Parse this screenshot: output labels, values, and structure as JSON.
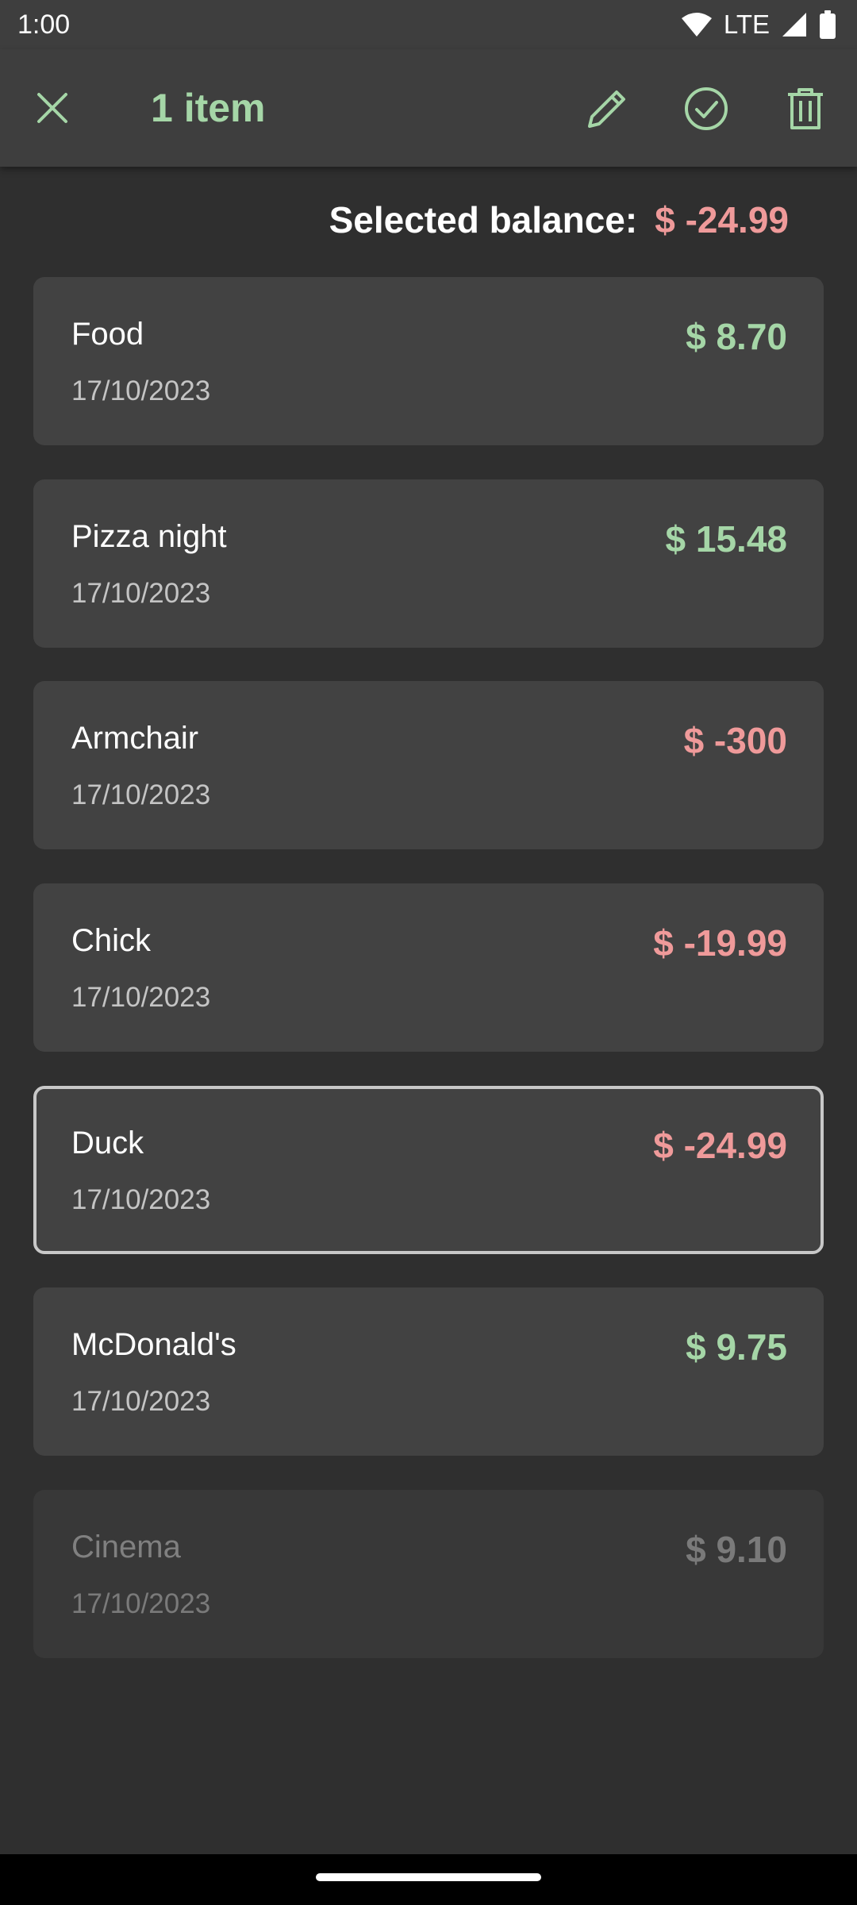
{
  "status_bar": {
    "time": "1:00",
    "network": "LTE",
    "icons": [
      "wifi-icon",
      "cell-signal-icon",
      "battery-icon"
    ]
  },
  "app_bar": {
    "title": "1 item",
    "actions": [
      "close-icon",
      "pencil-icon",
      "check-circle-icon",
      "trash-icon"
    ]
  },
  "balance": {
    "label": "Selected balance:",
    "value": "$ -24.99"
  },
  "colors": {
    "accent_green": "#a5d6a7",
    "negative_red": "#ef9a9a",
    "faded_gray": "#7a7a7a"
  },
  "transactions": [
    {
      "name": "Food",
      "date": "17/10/2023",
      "amount": "$ 8.70",
      "tone": "positive",
      "selected": false,
      "faded": false
    },
    {
      "name": "Pizza night",
      "date": "17/10/2023",
      "amount": "$ 15.48",
      "tone": "positive",
      "selected": false,
      "faded": false
    },
    {
      "name": "Armchair",
      "date": "17/10/2023",
      "amount": "$ -300",
      "tone": "negative",
      "selected": false,
      "faded": false
    },
    {
      "name": "Chick",
      "date": "17/10/2023",
      "amount": "$ -19.99",
      "tone": "negative",
      "selected": false,
      "faded": false
    },
    {
      "name": "Duck",
      "date": "17/10/2023",
      "amount": "$ -24.99",
      "tone": "negative",
      "selected": true,
      "faded": false
    },
    {
      "name": "McDonald's",
      "date": "17/10/2023",
      "amount": "$ 9.75",
      "tone": "positive",
      "selected": false,
      "faded": false
    },
    {
      "name": "Cinema",
      "date": "17/10/2023",
      "amount": "$ 9.10",
      "tone": "faded",
      "selected": false,
      "faded": true
    }
  ]
}
